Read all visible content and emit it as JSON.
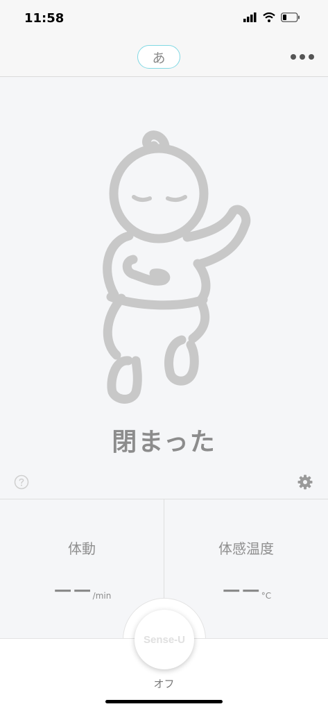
{
  "status_bar": {
    "time": "11:58"
  },
  "nav": {
    "lang_label": "あ"
  },
  "device": {
    "state": "閉まった"
  },
  "metrics": [
    {
      "label": "体動",
      "value": "－－",
      "unit": "/min"
    },
    {
      "label": "体感温度",
      "value": "－－",
      "unit": "°C"
    }
  ],
  "power": {
    "label": "Sense-U",
    "status": "オフ"
  },
  "colors": {
    "accent_border": "#80d8e3",
    "baby_stroke": "#c8c8c8"
  },
  "icons": [
    "cellular-signal-icon",
    "wifi-icon",
    "battery-icon",
    "more-icon",
    "help-icon",
    "settings-icon",
    "baby-icon"
  ]
}
